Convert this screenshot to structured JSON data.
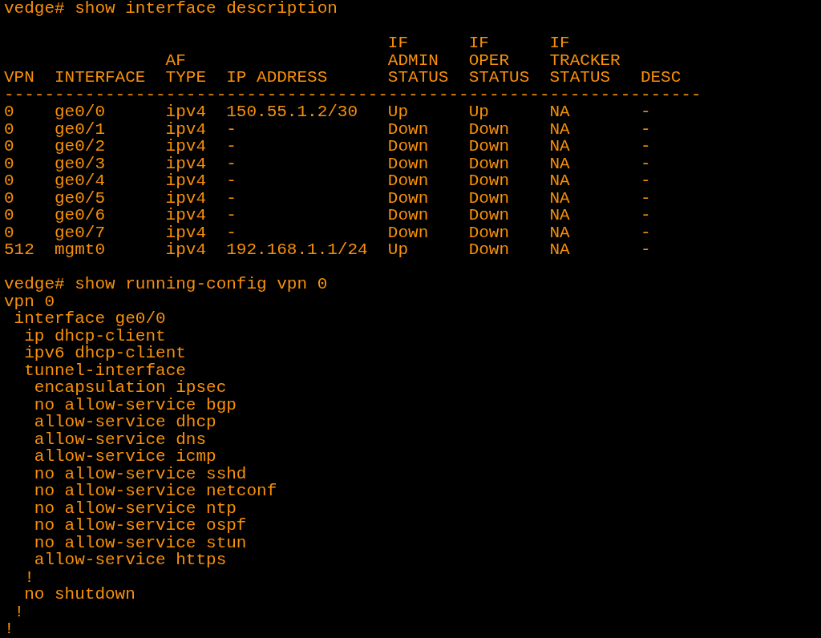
{
  "commands": [
    {
      "prompt": "vedge#",
      "command": "show interface description"
    },
    {
      "prompt": "vedge#",
      "command": "show running-config vpn 0"
    }
  ],
  "interface_table": {
    "columns": [
      {
        "lines": [
          "VPN"
        ]
      },
      {
        "lines": [
          "INTERFACE"
        ]
      },
      {
        "lines": [
          "AF",
          "TYPE"
        ]
      },
      {
        "lines": [
          "IP ADDRESS"
        ]
      },
      {
        "lines": [
          "IF",
          "ADMIN",
          "STATUS"
        ]
      },
      {
        "lines": [
          "IF",
          "OPER",
          "STATUS"
        ]
      },
      {
        "lines": [
          "IF",
          "TRACKER",
          "STATUS"
        ]
      },
      {
        "lines": [
          "DESC"
        ]
      }
    ],
    "separator": "---------------------------------------------------------------------",
    "rows": [
      [
        "0",
        "ge0/0",
        "ipv4",
        "150.55.1.2/30",
        "Up",
        "Up",
        "NA",
        "-"
      ],
      [
        "0",
        "ge0/1",
        "ipv4",
        "-",
        "Down",
        "Down",
        "NA",
        "-"
      ],
      [
        "0",
        "ge0/2",
        "ipv4",
        "-",
        "Down",
        "Down",
        "NA",
        "-"
      ],
      [
        "0",
        "ge0/3",
        "ipv4",
        "-",
        "Down",
        "Down",
        "NA",
        "-"
      ],
      [
        "0",
        "ge0/4",
        "ipv4",
        "-",
        "Down",
        "Down",
        "NA",
        "-"
      ],
      [
        "0",
        "ge0/5",
        "ipv4",
        "-",
        "Down",
        "Down",
        "NA",
        "-"
      ],
      [
        "0",
        "ge0/6",
        "ipv4",
        "-",
        "Down",
        "Down",
        "NA",
        "-"
      ],
      [
        "0",
        "ge0/7",
        "ipv4",
        "-",
        "Down",
        "Down",
        "NA",
        "-"
      ],
      [
        "512",
        "mgmt0",
        "ipv4",
        "192.168.1.1/24",
        "Up",
        "Down",
        "NA",
        "-"
      ]
    ]
  },
  "config": [
    {
      "text": "vpn 0",
      "children": [
        {
          "text": "interface ge0/0",
          "children": [
            {
              "text": "ip dhcp-client"
            },
            {
              "text": "ipv6 dhcp-client"
            },
            {
              "text": "tunnel-interface",
              "children": [
                {
                  "text": "encapsulation ipsec"
                },
                {
                  "text": "no allow-service bgp"
                },
                {
                  "text": "allow-service dhcp"
                },
                {
                  "text": "allow-service dns"
                },
                {
                  "text": "allow-service icmp"
                },
                {
                  "text": "no allow-service sshd"
                },
                {
                  "text": "no allow-service netconf"
                },
                {
                  "text": "no allow-service ntp"
                },
                {
                  "text": "no allow-service ospf"
                },
                {
                  "text": "no allow-service stun"
                },
                {
                  "text": "allow-service https"
                }
              ]
            },
            {
              "text": "!"
            },
            {
              "text": "no shutdown"
            }
          ]
        },
        {
          "text": "!"
        }
      ]
    },
    {
      "text": "!"
    }
  ]
}
